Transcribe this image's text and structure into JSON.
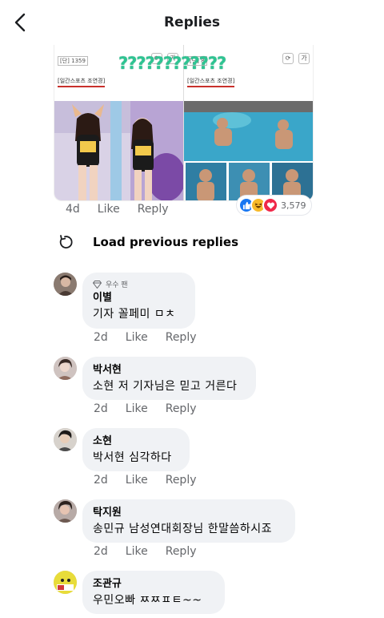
{
  "header": {
    "title": "Replies"
  },
  "post": {
    "time": "4d",
    "like_label": "Like",
    "reply_label": "Reply",
    "reaction_count": "3,579",
    "image": {
      "overlay_text": "????????????",
      "left_panel": {
        "id_tag": "[단] 1359",
        "news_label": "[일간스포츠 조연경]"
      },
      "right_panel": {
        "id_tag": "[단] 8",
        "news_label": "[일간스포츠 조연경]"
      },
      "font_icon_label": "가"
    }
  },
  "load_previous": {
    "label": "Load previous replies"
  },
  "comments": [
    {
      "badge": "우수 팬",
      "author": "이별",
      "text": "기자 꼴페미 ㅁㅊ",
      "time": "2d",
      "like_label": "Like",
      "reply_label": "Reply"
    },
    {
      "author": "박서현",
      "text": "소현 저 기자님은 믿고 거른다",
      "time": "2d",
      "like_label": "Like",
      "reply_label": "Reply"
    },
    {
      "author": "소현",
      "text": "박서현 심각하다",
      "time": "2d",
      "like_label": "Like",
      "reply_label": "Reply"
    },
    {
      "author": "탁지원",
      "text": "송민규 남성연대회장님 한말씀하시죠",
      "time": "2d",
      "like_label": "Like",
      "reply_label": "Reply"
    },
    {
      "author": "조관규",
      "text": "우민오빠 ㅉㅉㅍㅌ~~"
    }
  ],
  "colors": {
    "like": "#1877f2",
    "haha": "#f7b928",
    "love": "#f02849",
    "bubble": "#f0f2f5",
    "meta": "#65676b",
    "overlay": "#2ec492"
  }
}
